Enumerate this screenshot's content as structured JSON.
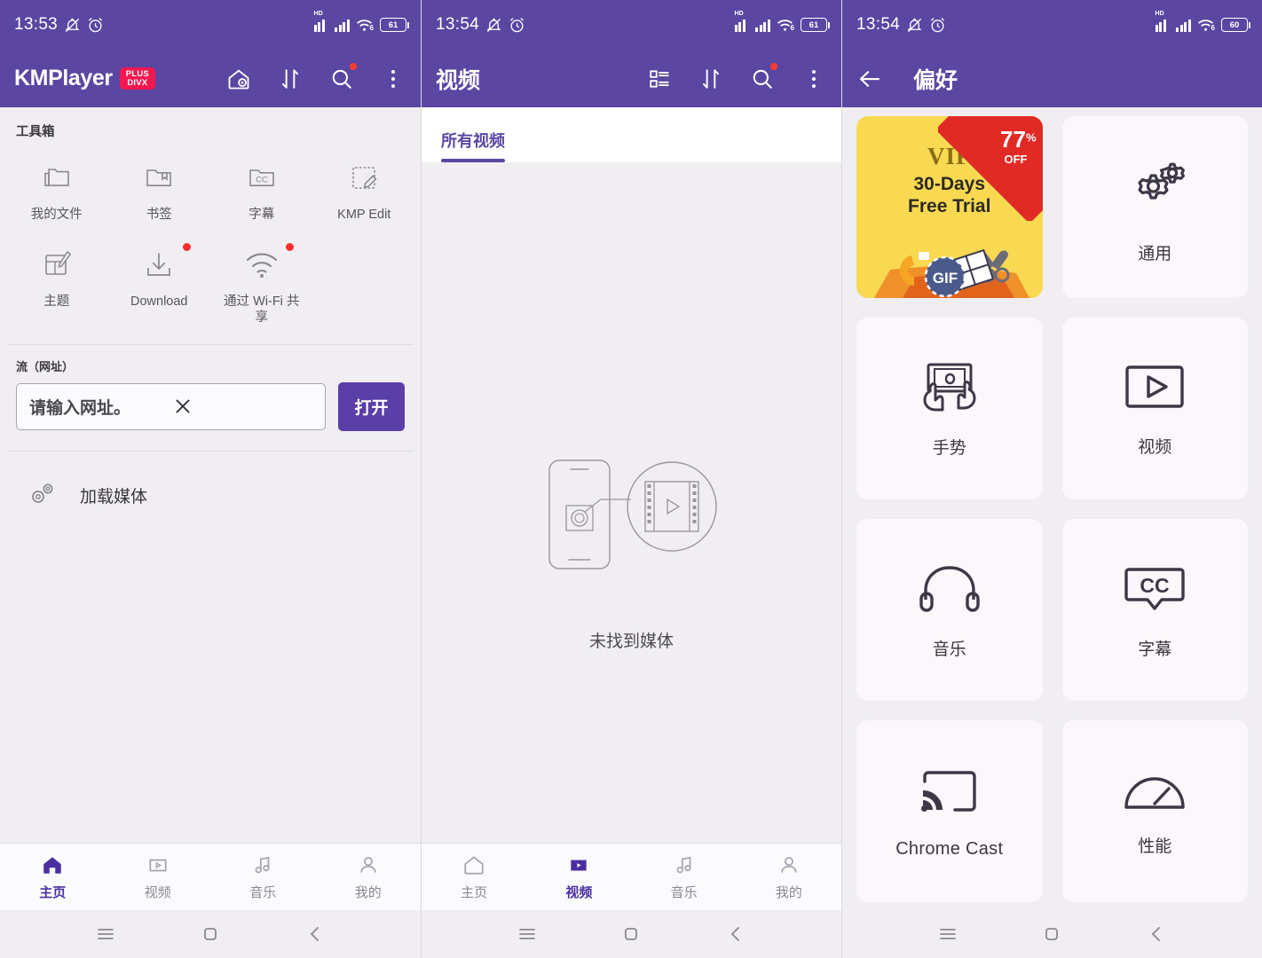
{
  "app": {
    "brand": "KMPlayer",
    "brand_badge_top": "PLUS",
    "brand_badge_bottom": "DIVX",
    "accent_purple": "#5b46a2",
    "accent_button": "#5b3fa8",
    "badge_red": "#f4174f",
    "page_bg": "#f0eef1",
    "tile_bg": "#fbf7fb"
  },
  "panel1": {
    "status": {
      "time": "13:53",
      "hd": "HD",
      "wifi_gen": "6",
      "battery": "61"
    },
    "toolbox_title": "工具箱",
    "tools": [
      {
        "label": "我的文件",
        "icon": "folder-icon",
        "badge": false
      },
      {
        "label": "书签",
        "icon": "bookmark-folder-icon",
        "badge": false
      },
      {
        "label": "字幕",
        "icon": "subtitle-cc-folder-icon",
        "badge": false
      },
      {
        "label": "KMP Edit",
        "icon": "edit-pen-icon",
        "badge": false
      },
      {
        "label": "主题",
        "icon": "theme-palette-icon",
        "badge": false
      },
      {
        "label": "Download",
        "icon": "download-icon",
        "badge": true
      },
      {
        "label": "通过 Wi-Fi 共享",
        "icon": "wifi-share-icon",
        "badge": true
      }
    ],
    "stream_label": "流（网址）",
    "stream_placeholder": "请输入网址。",
    "open_button": "打开",
    "load_media": "加载媒体",
    "bottom_nav": [
      {
        "label": "主页",
        "icon": "home-icon",
        "active": true
      },
      {
        "label": "视频",
        "icon": "video-icon",
        "active": false
      },
      {
        "label": "音乐",
        "icon": "music-icon",
        "active": false
      },
      {
        "label": "我的",
        "icon": "person-icon",
        "active": false
      }
    ]
  },
  "panel2": {
    "status": {
      "time": "13:54",
      "hd": "HD",
      "wifi_gen": "6",
      "battery": "61"
    },
    "title": "视频",
    "tab_label": "所有视频",
    "empty_text": "未找到媒体",
    "bottom_nav": [
      {
        "label": "主页",
        "icon": "home-icon",
        "active": false
      },
      {
        "label": "视频",
        "icon": "video-icon",
        "active": true
      },
      {
        "label": "音乐",
        "icon": "music-icon",
        "active": false
      },
      {
        "label": "我的",
        "icon": "person-icon",
        "active": false
      }
    ]
  },
  "panel3": {
    "status": {
      "time": "13:54",
      "hd": "HD",
      "wifi_gen": "6",
      "battery": "60"
    },
    "title": "偏好",
    "banner": {
      "crown": "♛",
      "vip": "VIP",
      "line1": "30-Days",
      "line2": "Free Trial",
      "discount_number": "77",
      "discount_percent": "%",
      "discount_off": "OFF",
      "gif_label": "GIF"
    },
    "tiles": [
      {
        "label": "通用",
        "icon": "gears-icon"
      },
      {
        "label": "手势",
        "icon": "gesture-hand-icon"
      },
      {
        "label": "视频",
        "icon": "video-play-box-icon"
      },
      {
        "label": "音乐",
        "icon": "headphones-icon"
      },
      {
        "label": "字幕",
        "icon": "cc-bubble-icon"
      },
      {
        "label": "Chrome Cast",
        "icon": "cast-icon"
      },
      {
        "label": "性能",
        "icon": "speedometer-icon"
      }
    ]
  },
  "system_nav": {
    "recents": "menu-icon",
    "home": "square-home-icon",
    "back": "chevron-left-icon"
  }
}
